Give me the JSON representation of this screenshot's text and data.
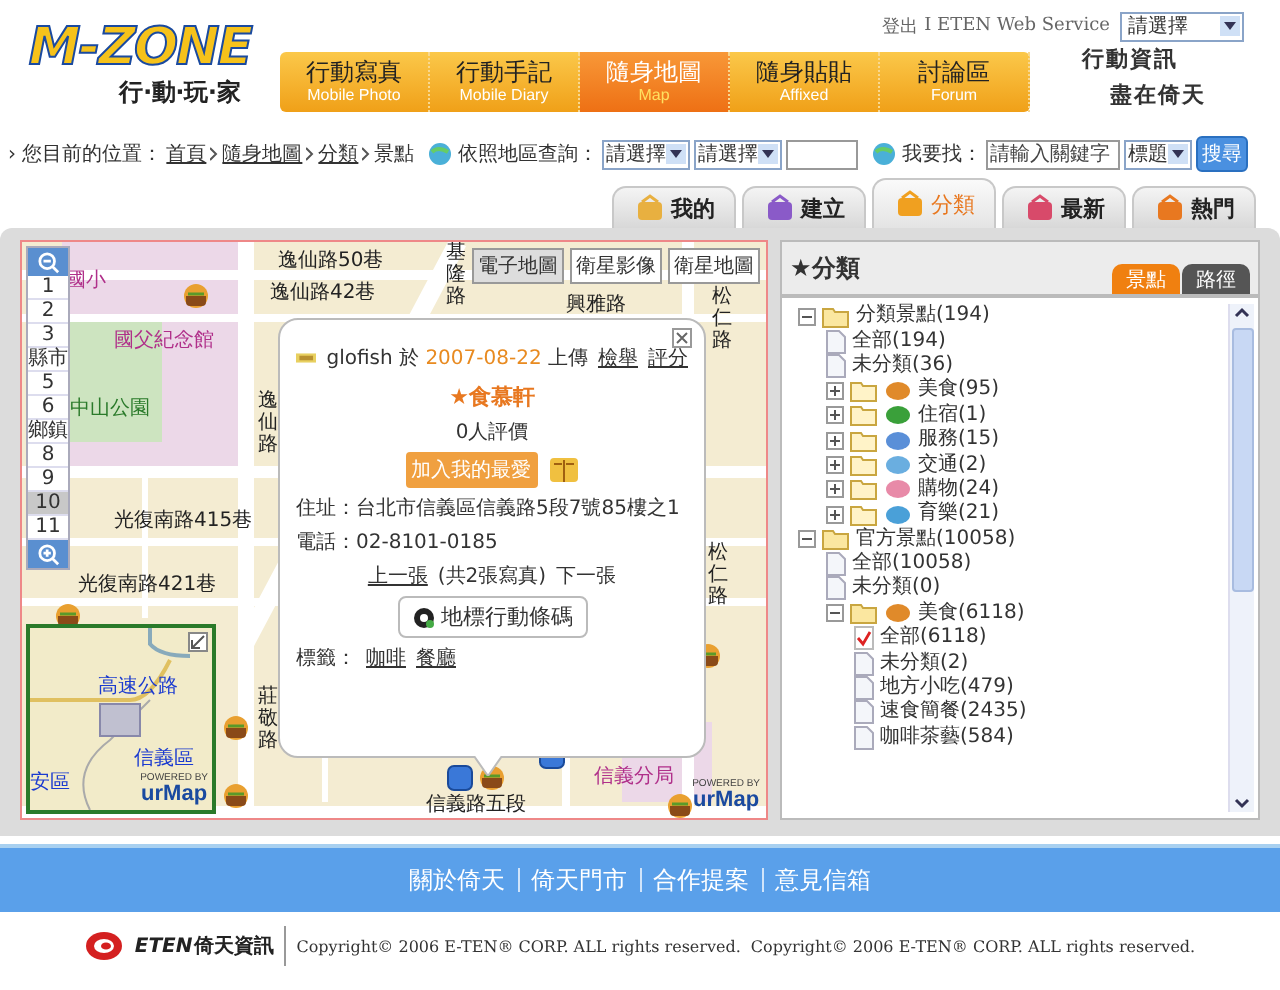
{
  "header": {
    "logo": "M-ZONE",
    "logo_subtitle": "行‧動‧玩‧家",
    "logout": "登出",
    "service": "I ETEN Web Service",
    "service_select": "請選擇",
    "nav": [
      {
        "label": "行動寫真",
        "sublabel": "Mobile Photo",
        "selected": false
      },
      {
        "label": "行動手記",
        "sublabel": "Mobile Diary",
        "selected": false
      },
      {
        "label": "隨身地圖",
        "sublabel": "Map",
        "selected": true
      },
      {
        "label": "隨身貼貼",
        "sublabel": "Affixed",
        "selected": false
      },
      {
        "label": "討論區",
        "sublabel": "Forum",
        "selected": false
      }
    ],
    "slogan": [
      "行動資訊",
      "盡在倚天"
    ]
  },
  "breadcrumb": {
    "label": "› 您目前的位置：",
    "items": [
      "首頁",
      "隨身地圖",
      "分類",
      "景點"
    ]
  },
  "region_search": {
    "label": "依照地區查詢：",
    "selects": [
      "請選擇",
      "請選擇"
    ]
  },
  "keyword_search": {
    "label": "我要找：",
    "placeholder": "請輸入關鍵字",
    "select": "標題",
    "button": "搜尋"
  },
  "tabs": [
    {
      "label": "我的",
      "selected": false
    },
    {
      "label": "建立",
      "selected": false
    },
    {
      "label": "分類",
      "selected": true
    },
    {
      "label": "最新",
      "selected": false
    },
    {
      "label": "熱門",
      "selected": false
    }
  ],
  "map": {
    "map_types": [
      {
        "label": "電子地圖",
        "selected": true
      },
      {
        "label": "衛星影像",
        "selected": false
      },
      {
        "label": "衛星地圖",
        "selected": false
      }
    ],
    "zoom_levels": [
      {
        "label": "1",
        "selected": false
      },
      {
        "label": "2",
        "selected": false
      },
      {
        "label": "3",
        "selected": false
      },
      {
        "label": "縣市",
        "selected": false
      },
      {
        "label": "5",
        "selected": false
      },
      {
        "label": "6",
        "selected": false
      },
      {
        "label": "鄉鎮",
        "selected": false
      },
      {
        "label": "8",
        "selected": false
      },
      {
        "label": "9",
        "selected": false
      },
      {
        "label": "10",
        "selected": true
      },
      {
        "label": "11",
        "selected": false
      }
    ],
    "labels": [
      {
        "text": "國小",
        "kind": "place"
      },
      {
        "text": "逸仙路50巷",
        "kind": "street"
      },
      {
        "text": "逸仙路42巷",
        "kind": "street"
      },
      {
        "text": "興雅路",
        "kind": "street"
      },
      {
        "text": "國父紀念館",
        "kind": "place"
      },
      {
        "text": "中山公園",
        "kind": "park"
      },
      {
        "text": "逸仙路",
        "kind": "street"
      },
      {
        "text": "基隆路",
        "kind": "street"
      },
      {
        "text": "松仁路",
        "kind": "street"
      },
      {
        "text": "光復南路415巷",
        "kind": "street"
      },
      {
        "text": "光復南路421巷",
        "kind": "street"
      },
      {
        "text": "松仁路",
        "kind": "street"
      },
      {
        "text": "莊敬路",
        "kind": "street"
      },
      {
        "text": "信義路五段",
        "kind": "street"
      },
      {
        "text": "信義分局",
        "kind": "place"
      }
    ],
    "credit": {
      "powered": "POWERED BY",
      "brand": "urMap"
    },
    "minimap": {
      "labels": [
        "高速公路",
        "信義區",
        "安區"
      ],
      "credit": {
        "powered": "POWERED BY",
        "brand": "urMap"
      }
    },
    "popup": {
      "uploader": "glofish",
      "upload_prefix": "於",
      "date": "2007-08-22",
      "upload_suffix": "上傳",
      "links": [
        "檢舉",
        "評分"
      ],
      "title": "★食慕軒",
      "ratings": "0人評價",
      "favorite_button": "加入我的最愛",
      "address": "住址：台北市信義區信義路5段7號85樓之1",
      "phone": "電話：02-8101-0185",
      "prev": "上一張",
      "count": "(共2張寫真)",
      "next": "下一張",
      "barcode_button": "地標行動條碼",
      "tags_label": "標籤：",
      "tags": [
        "咖啡",
        "餐廳"
      ]
    }
  },
  "sidebar": {
    "title": "★分類",
    "tabs": [
      {
        "label": "景點",
        "selected": true
      },
      {
        "label": "路徑",
        "selected": false
      }
    ],
    "tree": [
      {
        "kind": "folder",
        "label": "分類景點(194)",
        "expanded": true,
        "children": [
          {
            "kind": "page",
            "label": "全部(194)",
            "checked": false
          },
          {
            "kind": "page",
            "label": "未分類(36)",
            "checked": false
          },
          {
            "kind": "folder",
            "label": "美食(95)",
            "expanded": false
          },
          {
            "kind": "folder",
            "label": "住宿(1)",
            "expanded": false
          },
          {
            "kind": "folder",
            "label": "服務(15)",
            "expanded": false
          },
          {
            "kind": "folder",
            "label": "交通(2)",
            "expanded": false
          },
          {
            "kind": "folder",
            "label": "購物(24)",
            "expanded": false
          },
          {
            "kind": "folder",
            "label": "育樂(21)",
            "expanded": false
          }
        ]
      },
      {
        "kind": "folder",
        "label": "官方景點(10058)",
        "expanded": true,
        "children": [
          {
            "kind": "page",
            "label": "全部(10058)",
            "checked": false
          },
          {
            "kind": "page",
            "label": "未分類(0)",
            "checked": false
          },
          {
            "kind": "folder",
            "label": "美食(6118)",
            "expanded": true,
            "children": [
              {
                "kind": "page",
                "label": "全部(6118)",
                "checked": true
              },
              {
                "kind": "page",
                "label": "未分類(2)",
                "checked": false
              },
              {
                "kind": "page",
                "label": "地方小吃(479)",
                "checked": false
              },
              {
                "kind": "page",
                "label": "速食簡餐(2435)",
                "checked": false
              },
              {
                "kind": "page",
                "label": "咖啡茶藝(584)",
                "checked": false
              }
            ]
          }
        ]
      }
    ]
  },
  "footer": {
    "links": [
      "關於倚天",
      "倚天門市",
      "合作提案",
      "意見信箱"
    ],
    "logo": "ETEN",
    "logo_name": "倚天資訊",
    "copyrights": [
      "Copyright© 2006 E-TEN® CORP. ALL rights reserved.",
      "Copyright© 2006 E-TEN® CORP. ALL rights reserved."
    ]
  }
}
